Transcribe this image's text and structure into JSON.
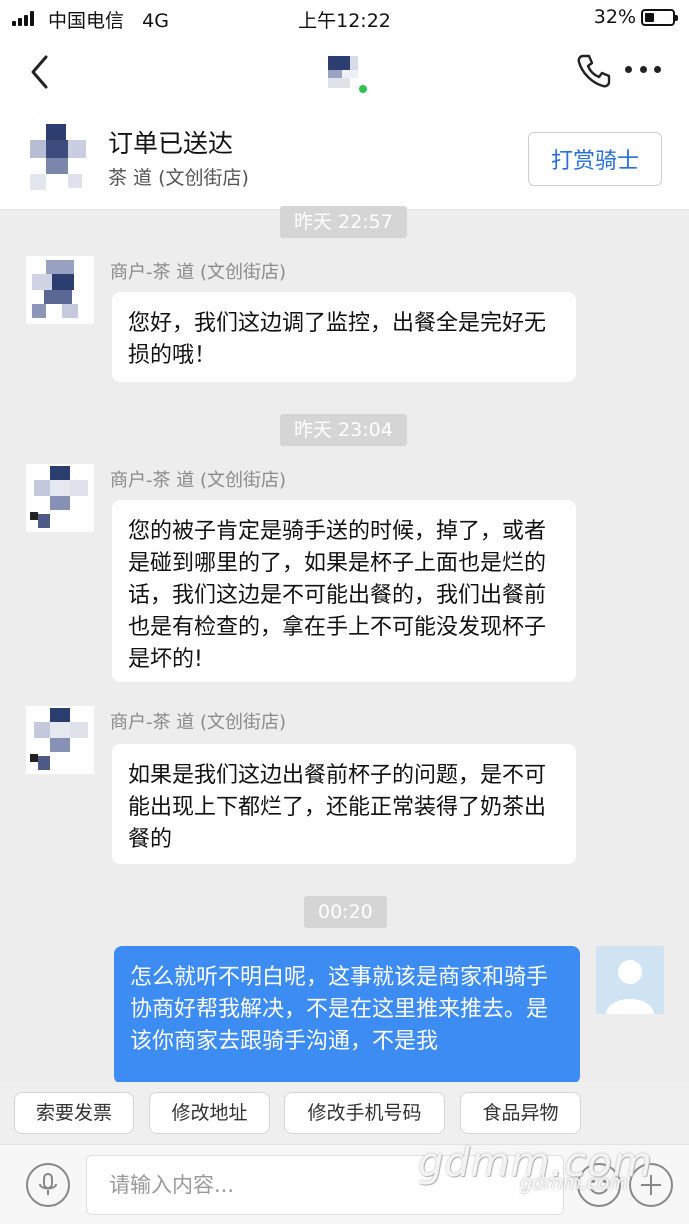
{
  "status_bar": {
    "carrier": "中国电信",
    "network": "4G",
    "time": "上午12:22",
    "battery": "32%"
  },
  "header": {
    "back_icon": "chevron-left-icon",
    "phone_icon": "phone-icon",
    "more_icon": "more-dots-icon"
  },
  "order": {
    "status": "订单已送达",
    "shop": "茶   道 (文创街店)",
    "reward_label": "打赏骑士"
  },
  "messages": [
    {
      "type": "time",
      "text": "昨天 22:57"
    },
    {
      "type": "incoming",
      "sender": "商户-茶   道 (文创街店)",
      "text": "您好，我们这边调了监控，出餐全是完好无损的哦！"
    },
    {
      "type": "time",
      "text": "昨天 23:04"
    },
    {
      "type": "incoming",
      "sender": "商户-茶   道 (文创街店)",
      "text": "您的被子肯定是骑手送的时候，掉了，或者是碰到哪里的了，如果是杯子上面也是烂的话，我们这边是不可能出餐的，我们出餐前也是有检查的，拿在手上不可能没发现杯子是坏的!"
    },
    {
      "type": "incoming",
      "sender": "商户-茶   道 (文创街店)",
      "text": "如果是我们这边出餐前杯子的问题，是不可能出现上下都烂了，还能正常装得了奶茶出餐的"
    },
    {
      "type": "time",
      "text": "00:20"
    },
    {
      "type": "outgoing",
      "text": "怎么就听不明白呢，这事就该是商家和骑手协商好帮我解决，不是在这里推来推去。是该你商家去跟骑手沟通，不是我"
    }
  ],
  "quick_replies": [
    "索要发票",
    "修改地址",
    "修改手机号码",
    "食品异物"
  ],
  "input": {
    "placeholder": "请输入内容..."
  },
  "watermark": {
    "main": "gdmm.com",
    "sub": "gdmm.com"
  },
  "colors": {
    "accent": "#3d8cf4",
    "reward_text": "#2a6fd6",
    "online": "#2ec14f",
    "background": "#ededed"
  }
}
